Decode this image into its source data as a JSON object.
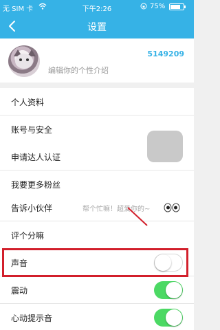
{
  "statusbar": {
    "carrier": "无 SIM 卡",
    "time": "下午2:26",
    "battery_text": "75%",
    "battery_level": 75
  },
  "navbar": {
    "title": "设置"
  },
  "profile": {
    "uid": "5149209",
    "bio": "编辑你的个性介绍"
  },
  "section1": [
    {
      "label": "个人资料"
    },
    {
      "label": "账号与安全"
    }
  ],
  "section2": [
    {
      "label": "申请达人认证"
    },
    {
      "label": "我要更多粉丝"
    }
  ],
  "section3": [
    {
      "label": "告诉小伙伴",
      "hint": "帮个忙嘛！超爱你的~"
    },
    {
      "label": "评个分嘛"
    }
  ],
  "section4": [
    {
      "label": "声音",
      "toggle": "off"
    },
    {
      "label": "震动",
      "toggle": "on"
    },
    {
      "label": "心动提示音",
      "toggle": "on"
    }
  ],
  "colors": {
    "accent": "#36b2e6",
    "toggle_on": "#4cd964",
    "highlight": "#d21f2b"
  }
}
